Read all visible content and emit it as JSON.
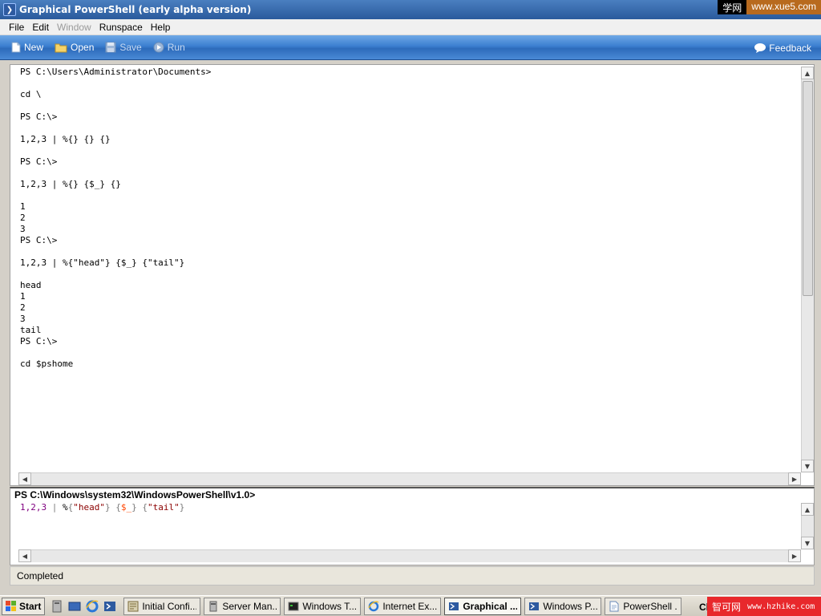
{
  "window": {
    "title": "Graphical PowerShell (early alpha version)"
  },
  "watermarks": {
    "top_label": "学网",
    "top_url": "www.xue5.com",
    "bottom_label": "智可网",
    "bottom_url": "www.hzhike.com"
  },
  "menu": {
    "items": [
      {
        "label": "File",
        "enabled": true
      },
      {
        "label": "Edit",
        "enabled": true
      },
      {
        "label": "Window",
        "enabled": false
      },
      {
        "label": "Runspace",
        "enabled": true
      },
      {
        "label": "Help",
        "enabled": true
      }
    ]
  },
  "toolbar": {
    "new_label": "New",
    "open_label": "Open",
    "save_label": "Save",
    "run_label": "Run",
    "feedback_label": "Feedback"
  },
  "output": {
    "lines": [
      "PS C:\\Users\\Administrator\\Documents>",
      "",
      "cd \\",
      "",
      "PS C:\\>",
      "",
      "1,2,3 | %{} {} {}",
      "",
      "PS C:\\>",
      "",
      "1,2,3 | %{} {$_} {}",
      "",
      "1",
      "2",
      "3",
      "PS C:\\>",
      "",
      "1,2,3 | %{\"head\"} {$_} {\"tail\"}",
      "",
      "head",
      "1",
      "2",
      "3",
      "tail",
      "PS C:\\>",
      "",
      "cd $pshome"
    ]
  },
  "prompt": {
    "label": "PS C:\\Windows\\system32\\WindowsPowerShell\\v1.0>"
  },
  "input": {
    "tokens": [
      {
        "text": "1,2,3",
        "kind": "num"
      },
      {
        "text": " | ",
        "kind": "op"
      },
      {
        "text": "%",
        "kind": "cmd"
      },
      {
        "text": "{",
        "kind": "op"
      },
      {
        "text": "\"head\"",
        "kind": "str"
      },
      {
        "text": "} {",
        "kind": "op"
      },
      {
        "text": "$_",
        "kind": "var"
      },
      {
        "text": "} {",
        "kind": "op"
      },
      {
        "text": "\"tail\"",
        "kind": "str"
      },
      {
        "text": "}",
        "kind": "op"
      }
    ]
  },
  "status": {
    "text": "Completed"
  },
  "taskbar": {
    "start_label": "Start",
    "tray_clip_text": "Cl",
    "buttons": [
      {
        "label": "Initial Confi...",
        "icon": "config-icon",
        "active": false
      },
      {
        "label": "Server Man...",
        "icon": "server-icon",
        "active": false
      },
      {
        "label": "Windows T...",
        "icon": "terminal-icon",
        "active": false
      },
      {
        "label": "Internet Ex...",
        "icon": "ie-icon",
        "active": false
      },
      {
        "label": "Graphical ...",
        "icon": "powershell-icon",
        "active": true
      },
      {
        "label": "Windows P...",
        "icon": "powershell-icon",
        "active": false
      },
      {
        "label": "PowerShell ...",
        "icon": "document-icon",
        "active": false
      }
    ]
  },
  "colors": {
    "toolbar_blue": "#3b7fd0",
    "title_blue": "#2a5a9c",
    "string_token": "#8b0000",
    "variable_token": "#ff4500",
    "number_token": "#800080",
    "watermark_red": "#e8282c"
  }
}
